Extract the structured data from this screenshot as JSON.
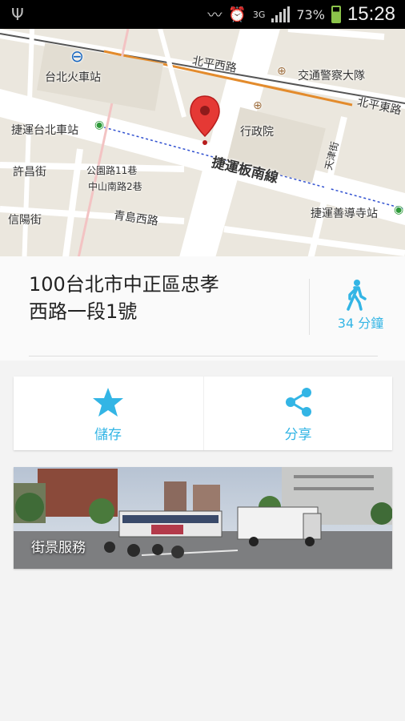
{
  "status_bar": {
    "usb_icon": "usb-icon",
    "icons": [
      "vibrate-icon",
      "alarm-icon"
    ],
    "network_type": "3G",
    "battery_percent": "73%",
    "time": "15:28"
  },
  "map": {
    "labels": {
      "station": "台北火車站",
      "beiping_west": "北平西路",
      "traffic_police": "交通警察大隊",
      "beiping_east": "北平東路",
      "mrt_taipei": "捷運台北車站",
      "executive_yuan": "行政院",
      "mrt_line": "捷運板南線",
      "xuchang": "許昌街",
      "gongyuan": "公園路11巷",
      "zhongshan_s": "中山南路2巷",
      "tianjin": "天津街",
      "mrt_shandao": "捷運善導寺站",
      "xinyang": "信陽街",
      "qingdao_west": "青島西路"
    },
    "pin_color": "#e53935"
  },
  "address": {
    "text_line1": "100台北市中正區忠孝",
    "text_line2": "西路一段1號",
    "walk_icon": "walking-person-icon",
    "walk_label": "34 分鐘"
  },
  "actions": {
    "save_icon": "star-icon",
    "save_label": "儲存",
    "share_icon": "share-icon",
    "share_label": "分享"
  },
  "streetview": {
    "label": "街景服務"
  },
  "colors": {
    "accent": "#33b5e5"
  }
}
